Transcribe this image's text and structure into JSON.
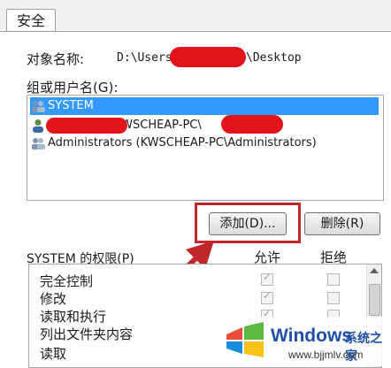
{
  "tab": {
    "label": "安全"
  },
  "object": {
    "label": "对象名称:",
    "path_prefix": "D:\\Users",
    "path_suffix": "\\Desktop"
  },
  "groups": {
    "label": "组或用户名(G):",
    "items": [
      {
        "name": "SYSTEM",
        "icon": "users-icon",
        "selected": true
      },
      {
        "name": "(KWSCHEAP-PC\\",
        "suffix": ")",
        "icon": "user-icon",
        "selected": false
      },
      {
        "name": "Administrators (KWSCHEAP-PC\\Administrators)",
        "icon": "users-icon",
        "selected": false
      }
    ]
  },
  "buttons": {
    "add": "添加(D)...",
    "remove": "删除(R)"
  },
  "permissions": {
    "label": "SYSTEM 的权限(P)",
    "allow_header": "允许",
    "deny_header": "拒绝",
    "rows": [
      {
        "name": "完全控制"
      },
      {
        "name": "修改"
      },
      {
        "name": "读取和执行"
      },
      {
        "name": "列出文件夹内容"
      },
      {
        "name": "读取"
      }
    ]
  },
  "watermark": {
    "title": "Windows",
    "subtitle": "系统之家",
    "url": "www.bjjmlv.com"
  },
  "colors": {
    "accent": "#3399ff",
    "highlight": "#c0272d",
    "redaction": "#e3131b"
  }
}
